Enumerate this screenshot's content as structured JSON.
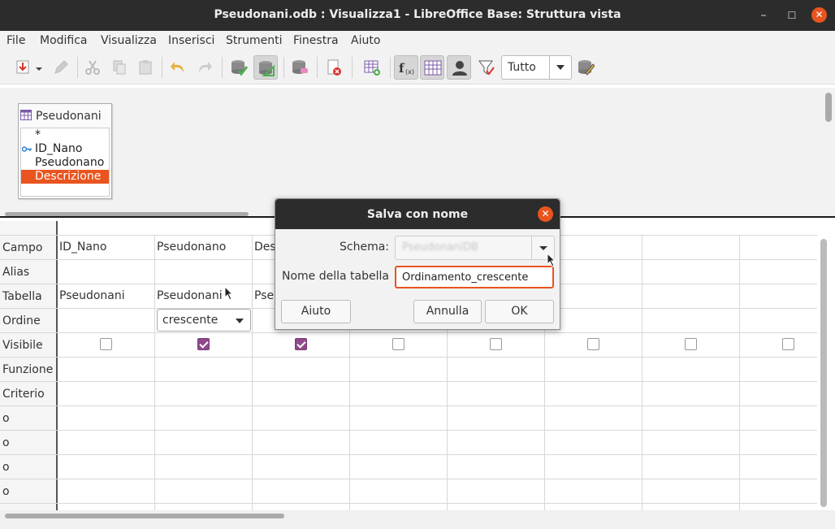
{
  "window": {
    "title": "Pseudonani.odb : Visualizza1 - LibreOffice Base: Struttura vista",
    "minimize": "–",
    "maximize": "☐",
    "close": "✕"
  },
  "menu": [
    "File",
    "Modifica",
    "Visualizza",
    "Inserisci",
    "Strumenti",
    "Finestra",
    "Aiuto"
  ],
  "toolbar": {
    "filter_value": "Tutto"
  },
  "table_window": {
    "name": "Pseudonani",
    "fields": [
      "*",
      "ID_Nano",
      "Pseudonano",
      "Descrizione"
    ],
    "selected_field": "Descrizione"
  },
  "grid": {
    "row_labels": [
      "Campo",
      "Alias",
      "Tabella",
      "Ordine",
      "Visibile",
      "Funzione",
      "Criterio",
      "o",
      "o",
      "o",
      "o"
    ],
    "columns": [
      {
        "campo": "ID_Nano",
        "tabella": "Pseudonani",
        "visibile": false
      },
      {
        "campo": "Pseudonano",
        "tabella": "Pseudonani",
        "ordine": "crescente",
        "visibile": true
      },
      {
        "campo": "Des",
        "tabella": "Pse",
        "visibile": true
      },
      {
        "visibile": false
      },
      {
        "visibile": false
      },
      {
        "visibile": false
      },
      {
        "visibile": false
      },
      {
        "visibile": false
      }
    ]
  },
  "dialog": {
    "title": "Salva con nome",
    "close": "✕",
    "schema_label": "Schema:",
    "schema_value": "PseudonaniDB",
    "name_label": "Nome della tabella",
    "name_value": "Ordinamento_crescente",
    "help_button": "Aiuto",
    "cancel_button": "Annulla",
    "ok_button": "OK"
  },
  "colors": {
    "accent": "#e9541f",
    "check": "#8e4a8a",
    "titlebar": "#2c2c2c"
  }
}
